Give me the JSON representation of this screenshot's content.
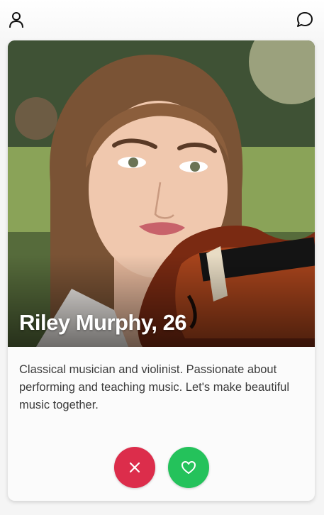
{
  "header": {
    "profile_icon": "person-icon",
    "chat_icon": "chat-bubble-icon"
  },
  "profile": {
    "name_age": "Riley Murphy, 26",
    "bio": "Classical musician and violinist. Passionate about performing and teaching music. Let's make beautiful music together.",
    "photo_description": "portrait photo"
  },
  "actions": {
    "pass_icon": "close-icon",
    "like_icon": "heart-icon"
  },
  "colors": {
    "pass": "#dc2d4b",
    "like": "#24c25b",
    "name_text": "#ffffff",
    "bio_text": "#3b3b3b"
  }
}
